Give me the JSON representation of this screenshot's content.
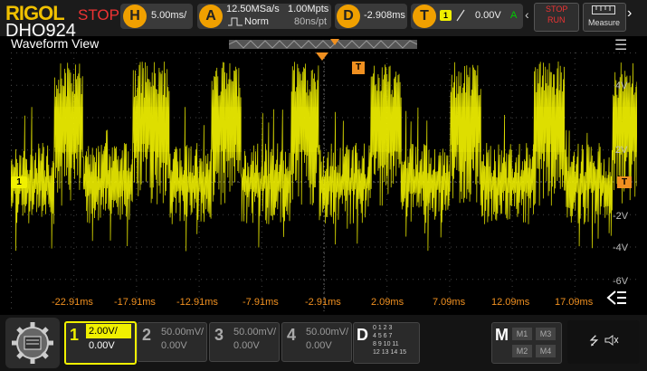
{
  "header": {
    "brand": "RIGOL",
    "run_state": "STOP",
    "model": "DHO924",
    "horizontal": {
      "key": "H",
      "value": "5.00ms/"
    },
    "acquire": {
      "key": "A",
      "rate": "12.50MSa/s",
      "mode": "Norm",
      "depth": "1.00Mpts",
      "interval": "80ns/pt"
    },
    "delay": {
      "key": "D",
      "value": "-2.908ms"
    },
    "trigger": {
      "key": "T",
      "source": "1",
      "level": "0.00V",
      "mode": "A"
    },
    "stop_run": {
      "line1": "STOP",
      "line2": "RUN"
    },
    "measure_label": "Measure"
  },
  "waveform": {
    "title": "Waveform View",
    "trigger_marker": "T",
    "ch1_marker": "1",
    "time_ticks": [
      "-22.91ms",
      "-17.91ms",
      "-12.91ms",
      "-7.91ms",
      "-2.91ms",
      "2.09ms",
      "7.09ms",
      "12.09ms",
      "17.09ms"
    ],
    "volt_ticks": [
      "4V",
      "2V",
      "-2V",
      "-4V",
      "-6V"
    ],
    "colors": {
      "ch1": "#f0f000",
      "accent": "#f09020"
    }
  },
  "channels": [
    {
      "num": "1",
      "scale": "2.00V/",
      "offset": "0.00V",
      "color": "#f0f000",
      "active": true
    },
    {
      "num": "2",
      "scale": "50.00mV/",
      "offset": "0.00V",
      "color": "#aaaaaa",
      "active": false
    },
    {
      "num": "3",
      "scale": "50.00mV/",
      "offset": "0.00V",
      "color": "#aaaaaa",
      "active": false
    },
    {
      "num": "4",
      "scale": "50.00mV/",
      "offset": "0.00V",
      "color": "#aaaaaa",
      "active": false
    }
  ],
  "digital": {
    "label": "D",
    "rows": [
      "0 1 2 3",
      "4 5 6 7",
      "8 9 10 11",
      "12 13 14 15"
    ]
  },
  "math": {
    "label": "M",
    "items": [
      "M1",
      "M3",
      "M2",
      "M4"
    ]
  }
}
